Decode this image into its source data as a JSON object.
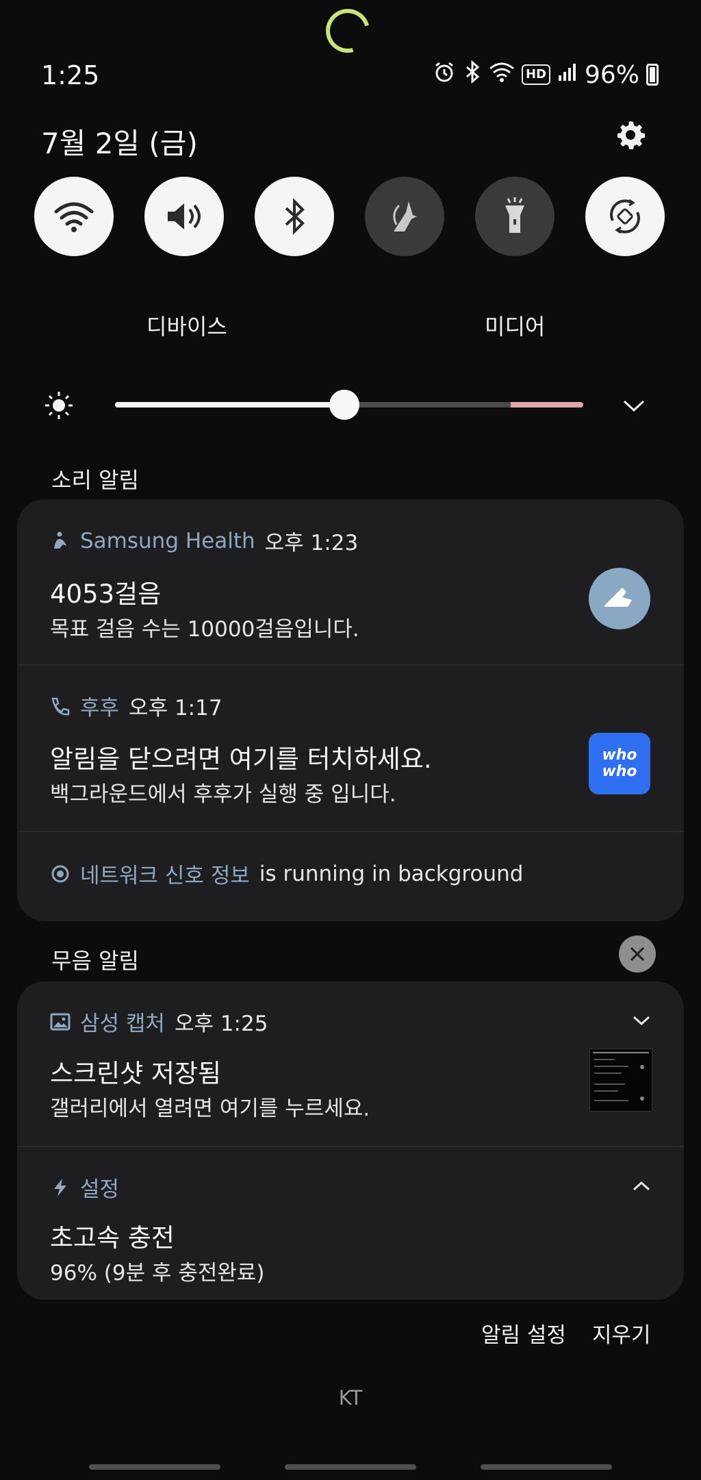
{
  "status_bar": {
    "time": "1:25",
    "battery": "96%",
    "icons": [
      "alarm-icon",
      "bluetooth-icon",
      "wifi-icon",
      "hd-voice-icon",
      "signal-icon",
      "battery-charging-icon"
    ],
    "hd_label": "HD"
  },
  "header": {
    "date": "7월 2일 (금)"
  },
  "quick_settings": [
    {
      "icon": "wifi-icon",
      "on": true
    },
    {
      "icon": "sound-icon",
      "on": true
    },
    {
      "icon": "bluetooth-icon",
      "on": true
    },
    {
      "icon": "power-saving-icon",
      "on": false
    },
    {
      "icon": "flashlight-icon",
      "on": false
    },
    {
      "icon": "auto-rotate-icon",
      "on": true
    }
  ],
  "panel_buttons": {
    "device": "디바이스",
    "media": "미디어"
  },
  "brightness": {
    "level": 0.49
  },
  "sound_notifications": {
    "section_title": "소리 알림",
    "items": [
      {
        "app": "Samsung Health",
        "time": "오후 1:23",
        "title": "4053걸음",
        "body": "목표 걸음 수는 10000걸음입니다."
      },
      {
        "app": "후후",
        "time": "오후 1:17",
        "title": "알림을 닫으려면 여기를 터치하세요.",
        "body": "백그라운드에서 후후가 실행 중 입니다.",
        "badge_line1": "who",
        "badge_line2": "who"
      },
      {
        "app": "네트워크 신호 정보",
        "text": "is running in background"
      }
    ]
  },
  "silent_notifications": {
    "section_title": "무음 알림",
    "items": [
      {
        "app": "삼성 캡처",
        "time": "오후 1:25",
        "title": "스크린샷 저장됨",
        "body": "갤러리에서 열려면 여기를 누르세요."
      },
      {
        "app": "설정",
        "title": "초고속 충전",
        "body": "96% (9분 후 충전완료)"
      }
    ]
  },
  "footer": {
    "notification_settings": "알림 설정",
    "clear": "지우기",
    "carrier": "KT"
  },
  "colors": {
    "background": "#0c0c0d",
    "card": "#1e1e20",
    "app_name": "#8fa8bf",
    "brightness_warn": "#e3a7a7",
    "loading_ring": "#c9e27a"
  }
}
